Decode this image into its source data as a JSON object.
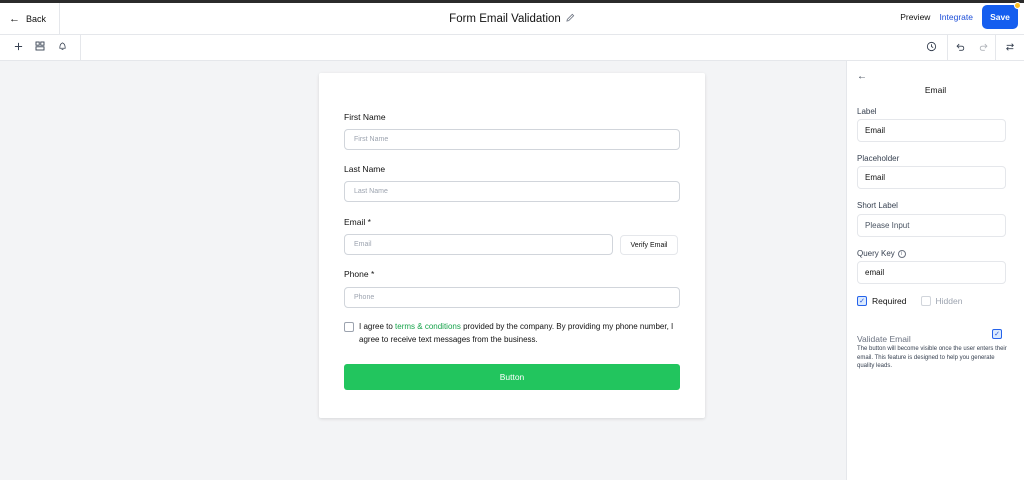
{
  "header": {
    "back_label": "Back",
    "title": "Form Email Validation",
    "preview_label": "Preview",
    "integrate_label": "Integrate",
    "save_label": "Save"
  },
  "toolbar": {
    "left_icons": [
      "plus-icon",
      "layout-icon",
      "bell-icon"
    ],
    "right_icons": [
      "history-icon",
      "undo-icon",
      "redo-icon",
      "swap-icon"
    ]
  },
  "form": {
    "fields": [
      {
        "label": "First Name",
        "placeholder": "First Name"
      },
      {
        "label": "Last Name",
        "placeholder": "Last Name"
      },
      {
        "label": "Email *",
        "placeholder": "Email"
      },
      {
        "label": "Phone *",
        "placeholder": "Phone"
      }
    ],
    "verify_label": "Verify Email",
    "consent_prefix": "I agree to ",
    "consent_link": "terms & conditions",
    "consent_suffix": " provided by the company. By providing my phone number, I agree to receive text messages from the business.",
    "submit_label": "Button"
  },
  "panel": {
    "title": "Email",
    "label_heading": "Label",
    "label_value": "Email",
    "placeholder_heading": "Placeholder",
    "placeholder_value": "Email",
    "short_label_heading": "Short Label",
    "short_label_placeholder": "Please Input",
    "query_key_heading": "Query Key",
    "query_key_value": "email",
    "required_label": "Required",
    "required_checked": true,
    "hidden_label": "Hidden",
    "hidden_checked": false,
    "validate_label": "Validate Email",
    "validate_checked": true,
    "validate_description": "The button will become visible once the user enters their email. This feature is designed to help you generate quality leads."
  },
  "colors": {
    "accent": "#155eef",
    "button_green": "#22c55e",
    "link_green": "#16a34a"
  }
}
